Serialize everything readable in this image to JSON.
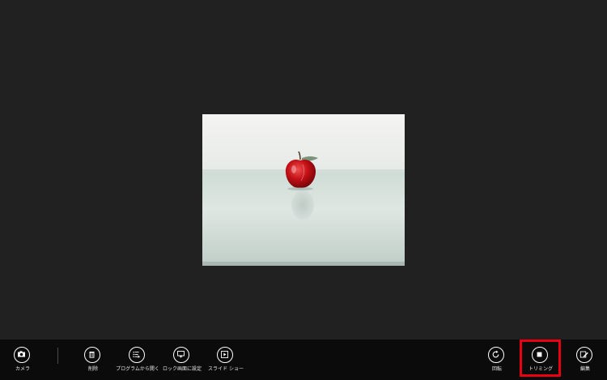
{
  "appbar": {
    "left": [
      {
        "id": "camera",
        "label": "カメラ",
        "icon": "camera-icon"
      },
      {
        "id": "delete",
        "label": "削除",
        "icon": "trash-icon"
      },
      {
        "id": "open-with",
        "label": "プログラムから開く",
        "icon": "open-with-icon"
      },
      {
        "id": "lock-screen",
        "label": "ロック画面に設定",
        "icon": "lock-screen-icon"
      },
      {
        "id": "slideshow",
        "label": "スライド ショー",
        "icon": "slideshow-icon"
      }
    ],
    "right": [
      {
        "id": "rotate",
        "label": "回転",
        "icon": "rotate-icon"
      },
      {
        "id": "crop",
        "label": "トリミング",
        "icon": "crop-icon"
      },
      {
        "id": "edit",
        "label": "編集",
        "icon": "edit-icon"
      }
    ]
  },
  "photo": {
    "subject": "apple-photo"
  },
  "colors": {
    "background": "#212121",
    "appbar": "#0b0b0b",
    "highlight": "#e60012",
    "apple": "#c41016",
    "leaf": "#6f8a6a"
  }
}
